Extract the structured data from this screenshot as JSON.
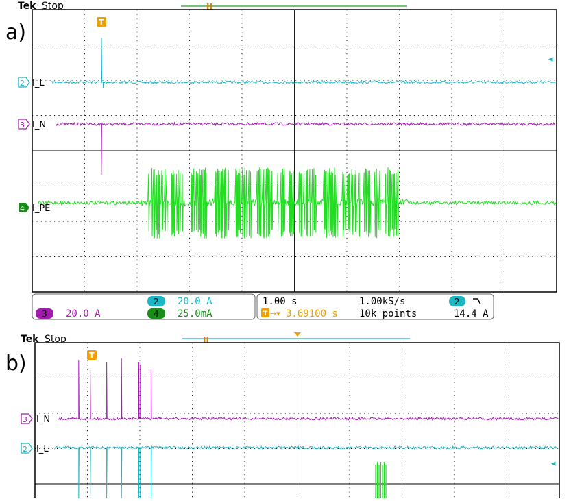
{
  "colors": {
    "ch2": "#1bb5c4",
    "ch3": "#a21caf",
    "ch4": "#22dd22",
    "ch4_dark": "#1a8c1a",
    "trigger": "#f0a000",
    "grid": "#000000"
  },
  "panel_a": {
    "label": "a)",
    "brand": "Tek",
    "status": "Stop",
    "trigger_marker": "T",
    "ch2_badge": "2",
    "ch2_label": "I_L",
    "ch3_badge": "3",
    "ch3_label": "I_N",
    "ch4_badge": "4",
    "ch4_label": "I_PE",
    "readout": {
      "ch2_num": "2",
      "ch2_scale": "20.0 A",
      "ch3_num": "3",
      "ch3_scale": "20.0 A",
      "ch4_num": "4",
      "ch4_scale": "25.0mA",
      "timebase": "1.00 s",
      "trig_offset": "3.69100 s",
      "sample_rate": "1.00kS/s",
      "record_length": "10k points",
      "trig_source": "2",
      "trig_slope": "↗",
      "trig_level": "14.4 A"
    }
  },
  "panel_b": {
    "label": "b)",
    "brand": "Tek",
    "status": "Stop",
    "trigger_marker": "T",
    "ch3_badge": "3",
    "ch3_label": "I_N",
    "ch2_badge": "2",
    "ch2_label": "I_L"
  },
  "chart_data": [
    {
      "type": "line",
      "panel": "a",
      "x_divisions": 10,
      "y_divisions": 8,
      "grid": true,
      "series": [
        {
          "name": "I_L",
          "channel": 2,
          "baseline_div": 2,
          "events": [
            "positive spike near 1.3 div"
          ]
        },
        {
          "name": "I_N",
          "channel": 3,
          "baseline_div": 2.8,
          "events": [
            "negative spike near 1.3 div"
          ]
        },
        {
          "name": "I_PE",
          "channel": 4,
          "baseline_div": 4.95,
          "events": [
            "bursts of pulses between 2.2 and 7.0 div"
          ]
        }
      ]
    },
    {
      "type": "line",
      "panel": "b",
      "x_divisions": 10,
      "grid": true,
      "series": [
        {
          "name": "I_N",
          "channel": 3,
          "events": [
            "positive pulses between 0.9 and 2.3 div"
          ]
        },
        {
          "name": "I_L",
          "channel": 2,
          "events": [
            "negative pulses between 0.9 and 2.3 div",
            "burst near 6.5 div"
          ]
        }
      ]
    }
  ]
}
